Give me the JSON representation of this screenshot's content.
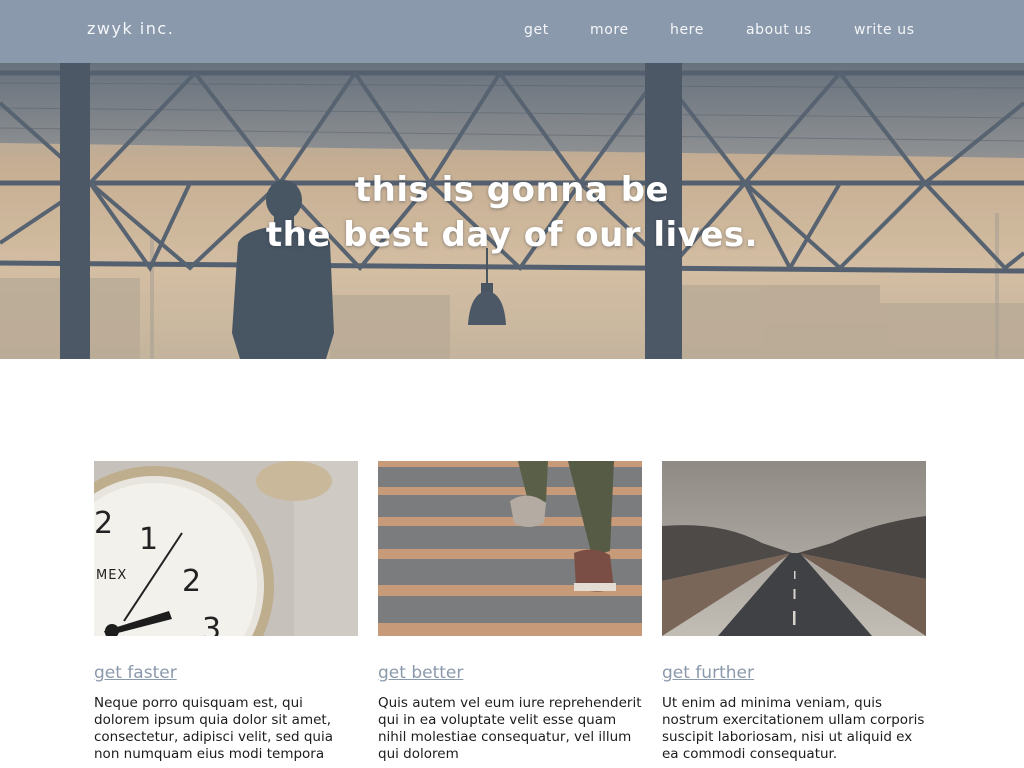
{
  "header": {
    "brand": "zwyk inc.",
    "nav": [
      "get",
      "more",
      "here",
      "about us",
      "write us"
    ]
  },
  "hero": {
    "line1": "this is gonna be",
    "line2": "the best day of our lives."
  },
  "cards": [
    {
      "title": "get faster",
      "image": "alarm-clock-photo",
      "text": "Neque porro quisquam est, qui dolorem ipsum quia dolor sit amet, consectetur, adipisci velit, sed quia non numquam eius modi tempora"
    },
    {
      "title": "get better",
      "image": "stairs-climbing-photo",
      "text": "Quis autem vel eum iure reprehenderit qui in ea voluptate velit esse quam nihil molestiae consequatur, vel illum qui dolorem"
    },
    {
      "title": "get further",
      "image": "open-road-photo",
      "text": "Ut enim ad minima veniam, quis nostrum exercitationem ullam corporis suscipit laboriosam, nisi ut aliquid ex ea commodi consequatur."
    }
  ],
  "colors": {
    "header_bg": "#8a99ab",
    "link": "#8a99ab",
    "hero_sky": "#d3b89a",
    "hero_steel": "#4a5a70"
  }
}
